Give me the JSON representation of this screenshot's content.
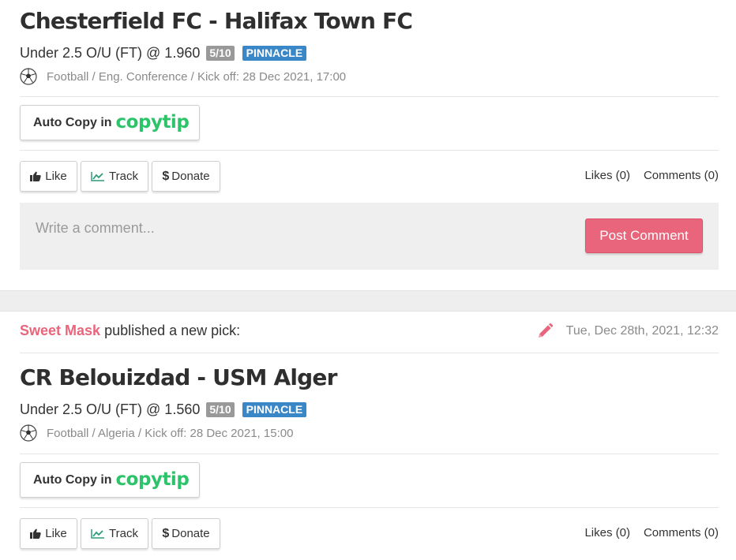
{
  "colors": {
    "accent": "#e8657b",
    "copytip": "#2cc36b",
    "bookmaker": "#3a87c8",
    "score": "#999999"
  },
  "posts": [
    {
      "title": "Chesterfield FC - Halifax Town FC",
      "pick": "Under 2.5 O/U (FT) @ 1.960",
      "score_badge": "5/10",
      "bookmaker_badge": "PINNACLE",
      "meta": "Football / Eng. Conference / Kick off: 28 Dec 2021, 17:00",
      "sport_icon": "soccer-ball-icon",
      "autocopy_text": "Auto Copy in",
      "autocopy_brand": "copytip",
      "buttons": {
        "like": "Like",
        "track": "Track",
        "donate": "Donate"
      },
      "likes": "Likes (0)",
      "comments": "Comments (0)",
      "comment_placeholder": "Write a comment...",
      "post_comment": "Post Comment"
    },
    {
      "author": "Sweet Mask",
      "published_text": "published a new pick:",
      "timestamp": "Tue, Dec 28th, 2021, 12:32",
      "title": "CR Belouizdad - USM Alger",
      "pick": "Under 2.5 O/U (FT) @ 1.560",
      "score_badge": "5/10",
      "bookmaker_badge": "PINNACLE",
      "meta": "Football / Algeria / Kick off: 28 Dec 2021, 15:00",
      "sport_icon": "soccer-ball-icon",
      "autocopy_text": "Auto Copy in",
      "autocopy_brand": "copytip",
      "buttons": {
        "like": "Like",
        "track": "Track",
        "donate": "Donate"
      },
      "likes": "Likes (0)",
      "comments": "Comments (0)"
    }
  ]
}
